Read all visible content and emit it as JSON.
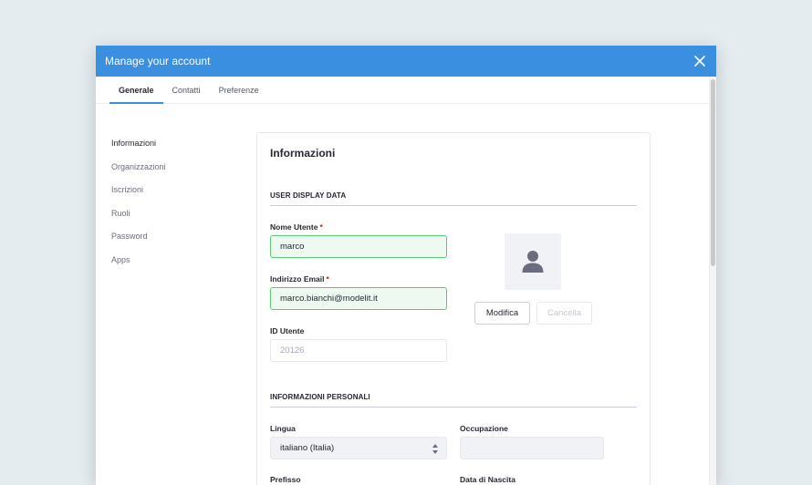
{
  "modal": {
    "title": "Manage your account",
    "close_icon": "close-icon"
  },
  "tabs": [
    {
      "label": "Generale",
      "active": true
    },
    {
      "label": "Contatti",
      "active": false
    },
    {
      "label": "Preferenze",
      "active": false
    }
  ],
  "sidebar": {
    "items": [
      {
        "label": "Informazioni",
        "active": true
      },
      {
        "label": "Organizzazioni",
        "active": false
      },
      {
        "label": "Iscrizioni",
        "active": false
      },
      {
        "label": "Ruoli",
        "active": false
      },
      {
        "label": "Password",
        "active": false
      },
      {
        "label": "Apps",
        "active": false
      }
    ]
  },
  "panel": {
    "title": "Informazioni",
    "section_user": "USER DISPLAY DATA",
    "section_personal": "INFORMAZIONI PERSONALI",
    "fields": {
      "username": {
        "label": "Nome Utente",
        "required_mark": "*",
        "value": "marco"
      },
      "email": {
        "label": "Indirizzo Email",
        "required_mark": "*",
        "value": "marco.bianchi@modelit.it"
      },
      "user_id": {
        "label": "ID Utente",
        "value": "20126"
      },
      "language": {
        "label": "Lingua",
        "value": "italiano (Italia)"
      },
      "occupation": {
        "label": "Occupazione",
        "value": ""
      },
      "prefix": {
        "label": "Prefisso"
      },
      "birthdate": {
        "label": "Data di Nascita"
      }
    },
    "avatar_icon": "user-icon",
    "buttons": {
      "edit": "Modifica",
      "cancel": "Cancella"
    }
  },
  "colors": {
    "header": "#3b8fe0",
    "valid_bg": "#eefaf1",
    "valid_border": "#5aca75",
    "required": "#da1414"
  }
}
